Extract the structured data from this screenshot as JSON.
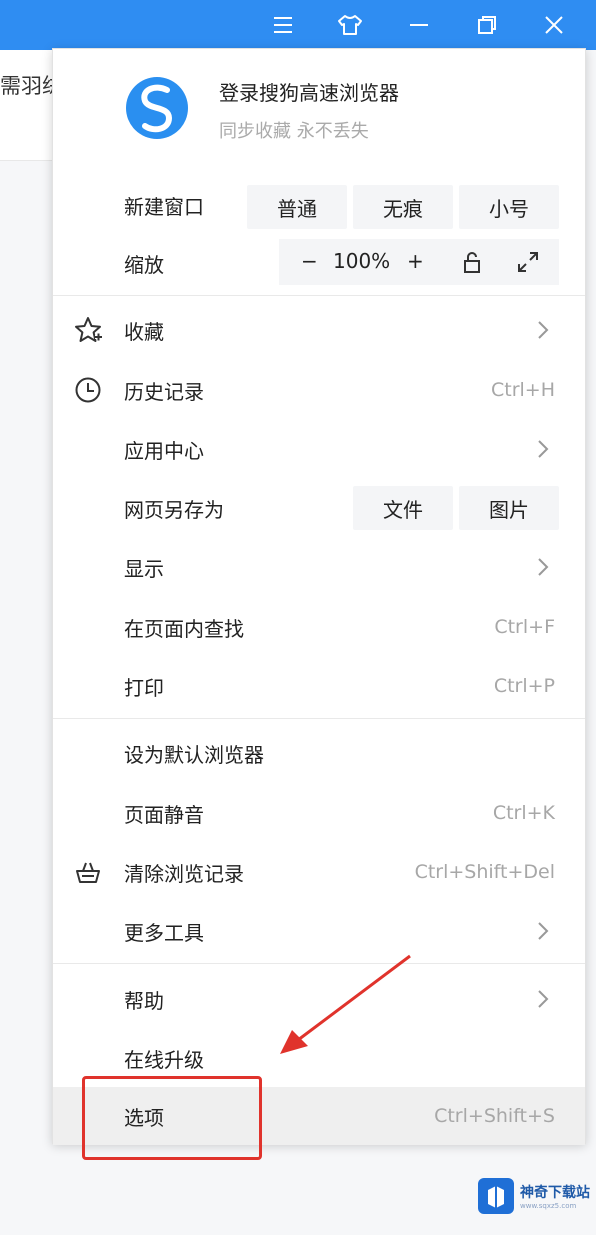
{
  "titlebar": {
    "buttons": [
      "menu-icon",
      "skin-icon",
      "minimize-icon",
      "restore-icon",
      "close-icon"
    ],
    "color": "#2f8df2"
  },
  "background_page": {
    "text": "需羽绒"
  },
  "account": {
    "title": "登录搜狗高速浏览器",
    "subtitle": "同步收藏 永不丢失"
  },
  "new_window": {
    "label": "新建窗口",
    "options": [
      "普通",
      "无痕",
      "小号"
    ]
  },
  "zoom": {
    "label": "缩放",
    "minus": "−",
    "value": "100%",
    "plus": "+"
  },
  "items": [
    {
      "label": "收藏",
      "icon": "star-plus-icon",
      "submenu": true
    },
    {
      "label": "历史记录",
      "icon": "clock-icon",
      "shortcut": "Ctrl+H"
    },
    {
      "label": "应用中心",
      "submenu": true
    },
    {
      "label": "网页另存为",
      "options": [
        "文件",
        "图片"
      ]
    },
    {
      "label": "显示",
      "submenu": true
    },
    {
      "label": "在页面内查找",
      "shortcut": "Ctrl+F"
    },
    {
      "label": "打印",
      "shortcut": "Ctrl+P"
    },
    {
      "label": "设为默认浏览器"
    },
    {
      "label": "页面静音",
      "shortcut": "Ctrl+K"
    },
    {
      "label": "清除浏览记录",
      "icon": "broom-basket-icon",
      "shortcut": "Ctrl+Shift+Del"
    },
    {
      "label": "更多工具",
      "submenu": true
    },
    {
      "label": "帮助",
      "submenu": true
    },
    {
      "label": "在线升级"
    },
    {
      "label": "选项",
      "shortcut": "Ctrl+Shift+S",
      "highlighted": true
    }
  ],
  "annotation": {
    "color": "#e0332c"
  },
  "watermark": {
    "name": "神奇下载站",
    "url": "www.sqxz5.com"
  }
}
